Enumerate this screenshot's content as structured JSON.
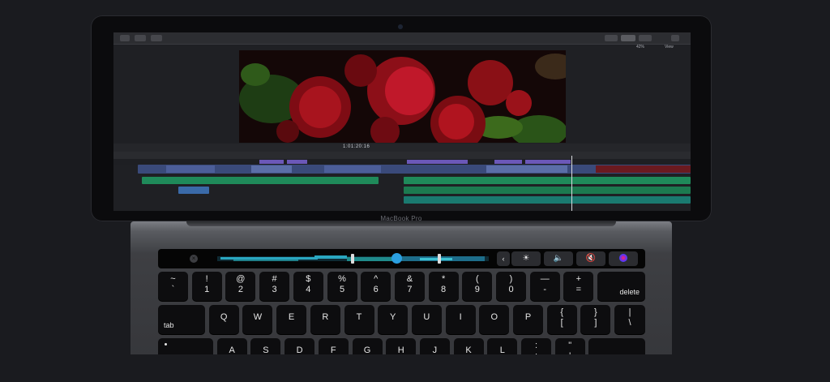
{
  "laptop": {
    "brand_label": "MacBook Pro"
  },
  "app": {
    "toolbar_left": [
      "",
      "",
      ""
    ],
    "toolbar_right": [
      "",
      "",
      ""
    ],
    "viewer_zoom": "42%",
    "viewer_menu": "View",
    "timecode": "1:01:20:16"
  },
  "touch_bar": {
    "esc_icon": "close-icon",
    "controls": [
      "chevron-left-icon",
      "brightness-icon",
      "volume-icon",
      "mute-icon",
      "siri-icon"
    ],
    "scrubber_position": 0.66
  },
  "keyboard": {
    "number_row": [
      {
        "top": "~",
        "bottom": "`"
      },
      {
        "top": "!",
        "bottom": "1"
      },
      {
        "top": "@",
        "bottom": "2"
      },
      {
        "top": "#",
        "bottom": "3"
      },
      {
        "top": "$",
        "bottom": "4"
      },
      {
        "top": "%",
        "bottom": "5"
      },
      {
        "top": "^",
        "bottom": "6"
      },
      {
        "top": "&",
        "bottom": "7"
      },
      {
        "top": "*",
        "bottom": "8"
      },
      {
        "top": "(",
        "bottom": "9"
      },
      {
        "top": ")",
        "bottom": "0"
      },
      {
        "top": "—",
        "bottom": "-"
      },
      {
        "top": "+",
        "bottom": "="
      }
    ],
    "delete": "delete",
    "tab": "tab",
    "qwerty_row": [
      "Q",
      "W",
      "E",
      "R",
      "T",
      "Y",
      "U",
      "I",
      "O",
      "P"
    ],
    "bracket_keys": [
      {
        "top": "{",
        "bottom": "["
      },
      {
        "top": "}",
        "bottom": "]"
      },
      {
        "top": "|",
        "bottom": "\\"
      }
    ],
    "home_row": [
      "A",
      "S",
      "D",
      "F",
      "G",
      "H",
      "J",
      "K",
      "L"
    ],
    "home_punct": [
      {
        "top": ":",
        "bottom": ";"
      },
      {
        "top": "\"",
        "bottom": "'"
      }
    ]
  }
}
